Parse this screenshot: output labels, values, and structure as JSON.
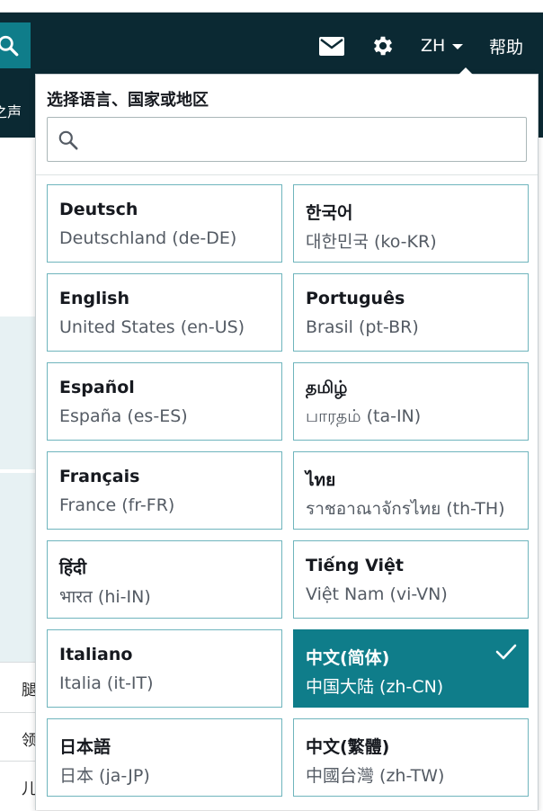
{
  "header": {
    "language_code": "ZH",
    "help_label": "帮助"
  },
  "subbar": {
    "partial_text": "之声"
  },
  "background_rows": [
    "腿",
    "领",
    "儿"
  ],
  "language_menu": {
    "title": "选择语言、国家或地区",
    "search_placeholder": "",
    "selected_code": "zh-CN",
    "languages": [
      {
        "name": "Deutsch",
        "region": "Deutschland (de-DE)",
        "code": "de-DE"
      },
      {
        "name": "한국어",
        "region": "대한민국 (ko-KR)",
        "code": "ko-KR"
      },
      {
        "name": "English",
        "region": "United States (en-US)",
        "code": "en-US"
      },
      {
        "name": "Português",
        "region": "Brasil (pt-BR)",
        "code": "pt-BR"
      },
      {
        "name": "Español",
        "region": "España (es-ES)",
        "code": "es-ES"
      },
      {
        "name": "தமிழ்",
        "region": "பாரதம் (ta-IN)",
        "code": "ta-IN"
      },
      {
        "name": "Français",
        "region": "France (fr-FR)",
        "code": "fr-FR"
      },
      {
        "name": "ไทย",
        "region": "ราชอาณาจักรไทย (th-TH)",
        "code": "th-TH"
      },
      {
        "name": "हिंदी",
        "region": "भारत (hi-IN)",
        "code": "hi-IN"
      },
      {
        "name": "Tiếng Việt",
        "region": "Việt Nam (vi-VN)",
        "code": "vi-VN"
      },
      {
        "name": "Italiano",
        "region": "Italia (it-IT)",
        "code": "it-IT"
      },
      {
        "name": "中文(简体)",
        "region": "中国大陆 (zh-CN)",
        "code": "zh-CN"
      },
      {
        "name": "日本語",
        "region": "日本 (ja-JP)",
        "code": "ja-JP"
      },
      {
        "name": "中文(繁體)",
        "region": "中國台灣 (zh-TW)",
        "code": "zh-TW"
      }
    ]
  },
  "colors": {
    "header_bg": "#0b2933",
    "accent": "#0f7d8a",
    "tile_border": "#6fb5bd"
  }
}
